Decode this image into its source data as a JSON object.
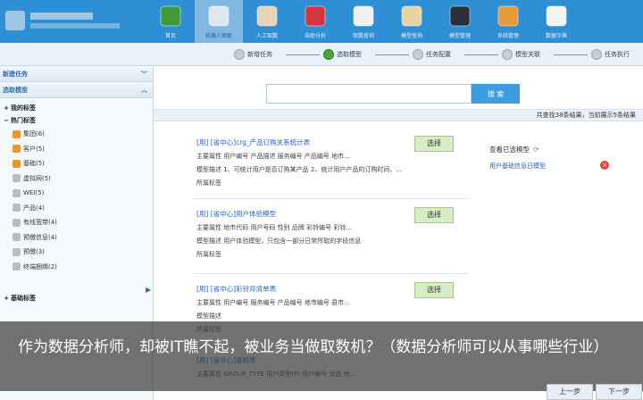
{
  "header": {
    "nav": [
      {
        "label": "首页",
        "icon": "home-icon",
        "color": "#3f9a3a"
      },
      {
        "label": "机器人助助",
        "icon": "robot-icon",
        "color": "#dfe8ee",
        "active": true
      },
      {
        "label": "人工取数",
        "icon": "person-icon",
        "color": "#e9d3b6"
      },
      {
        "label": "自助分析",
        "icon": "analysis-icon",
        "color": "#d2353b"
      },
      {
        "label": "取数查询",
        "icon": "query-icon",
        "color": "#f0f0f0"
      },
      {
        "label": "模型查询",
        "icon": "model-search-icon",
        "color": "#e8d3a5"
      },
      {
        "label": "模型管理",
        "icon": "gear-icon",
        "color": "#2a2f39"
      },
      {
        "label": "系统管理",
        "icon": "system-icon",
        "color": "#e89a3a"
      },
      {
        "label": "数据字典",
        "icon": "dictionary-icon",
        "color": "#f4f4f4"
      }
    ]
  },
  "steps": [
    {
      "label": "新增任务"
    },
    {
      "label": "选取模型",
      "current": true
    },
    {
      "label": "任务配置"
    },
    {
      "label": "模型关联"
    },
    {
      "label": "任务执行"
    }
  ],
  "sidebar": {
    "head1": "新建任务",
    "head2": "选取模型",
    "groups": [
      {
        "label": "我的标签",
        "toggle": "+"
      },
      {
        "label": "热门标签",
        "toggle": "−"
      }
    ],
    "items": [
      {
        "label": "集团(6)",
        "color": "#e8962e"
      },
      {
        "label": "客户(5)",
        "color": "#e8962e"
      },
      {
        "label": "基础(5)",
        "color": "#e8962e"
      },
      {
        "label": "虚拟网(5)",
        "color": "#b5bfc7"
      },
      {
        "label": "WEI(5)",
        "color": "#b5bfc7"
      },
      {
        "label": "产品(4)",
        "color": "#b5bfc7"
      },
      {
        "label": "有线宽带(4)",
        "color": "#b5bfc7"
      },
      {
        "label": "预缴信息(4)",
        "color": "#b5bfc7"
      },
      {
        "label": "预缴(3)",
        "color": "#b5bfc7"
      },
      {
        "label": "终端捆绑(2)",
        "color": "#b5bfc7"
      }
    ],
    "footer_group": {
      "label": "基础标签",
      "toggle": "+"
    }
  },
  "main": {
    "search_placeholder": "",
    "search_button": "搜 索",
    "result_summary": "共查找38条结果，当前展示5条结果",
    "cards": [
      {
        "title": "[用] [省中心]crg_产品订购关系统计表",
        "fields": "主要属性 用户编号  产品描述  服务编号  产品编号  地市...",
        "desc": "模型描述 1、可统计用户是否订购某产品  2、统计用户产品的订购时间、...",
        "tag": "所属标签",
        "pick": "选择"
      },
      {
        "title": "[用] [省中心]用户体验模型",
        "fields": "主要属性 地市代码  用户号码  性别  品牌  彩铃编号  彩铃...",
        "desc": "模型描述 用户体验模型，只包含一部分日常所取的字段信息",
        "tag": "所属标签",
        "pick": "选择"
      },
      {
        "title": "[用] [省中心]彩铃月清单表",
        "fields": "主要属性 用户编号  服务编号  产品编号  地市编号  县市...",
        "desc": "模型描述",
        "tag": "所属标签",
        "pick": "选择"
      },
      {
        "title": "[用] [省中心]基础表",
        "fields": "主要属性 GROUP_TYPE 用户类型(P) 用户编号  状态  地...",
        "desc": "",
        "tag": "",
        "pick": ""
      }
    ],
    "chosen_title": "查看已选模型",
    "chosen_items": [
      "用户基础信息日模型"
    ]
  },
  "caption": "作为数据分析师，却被IT瞧不起，被业务当做取数机？（数据分析师可以从事哪些行业）",
  "bottom_buttons": {
    "prev": "上一步",
    "next": "下一步"
  }
}
